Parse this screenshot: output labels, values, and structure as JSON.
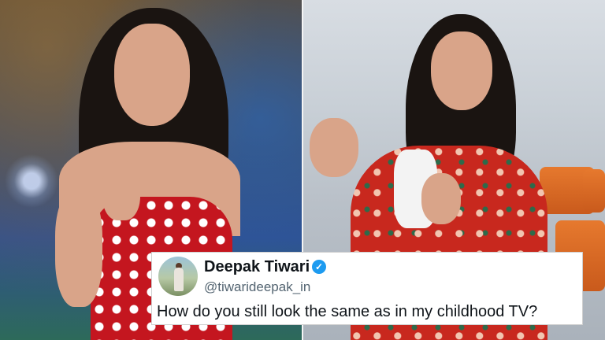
{
  "tweet": {
    "display_name": "Deepak Tiwari",
    "handle": "@tiwarideepak_in",
    "text": "How do you still look the same as in my childhood TV?",
    "verified_icon": "verified-check-icon",
    "verified_color": "#1d9bf0"
  },
  "photos": {
    "left_accent": "#c4161f",
    "right_accent": "#c8281e"
  }
}
